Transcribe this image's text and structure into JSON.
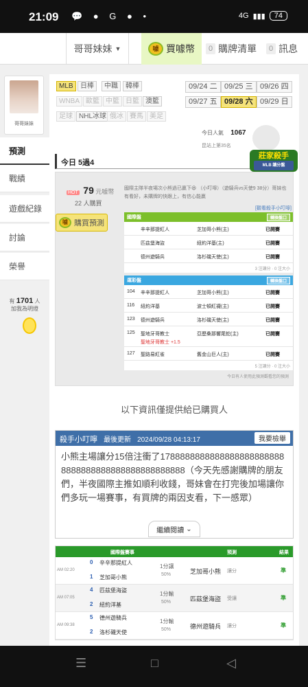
{
  "status": {
    "time": "21:09",
    "net": "4G",
    "battery": "74"
  },
  "nav": {
    "user": "哥哥妹妹",
    "buy_coin": "買噱幣",
    "coin_mark": "噱",
    "purchase_count": "0",
    "purchase_list": "購牌清單",
    "msg_count": "0",
    "messages": "訊息"
  },
  "profile": {
    "name": "哥哥妹妹"
  },
  "sidebar": {
    "items": [
      "預測",
      "戰績",
      "遊戲紀錄",
      "討論",
      "榮譽"
    ],
    "fans_prefix": "有",
    "fans_count": "1701",
    "fans_unit": "人",
    "fans_label": "加我為明燈"
  },
  "leagues": [
    {
      "label": "MLB",
      "state": "sel"
    },
    {
      "label": "日棒",
      "state": ""
    },
    {
      "label": "中職",
      "state": ""
    },
    {
      "label": "韓棒",
      "state": ""
    },
    {
      "label": "WNBA",
      "state": "dim"
    },
    {
      "label": "歐籃",
      "state": "dim"
    },
    {
      "label": "中籃",
      "state": "dim"
    },
    {
      "label": "日籃",
      "state": "dim"
    },
    {
      "label": "澳籃",
      "state": ""
    },
    {
      "label": "足球",
      "state": "dim"
    },
    {
      "label": "NHL冰球",
      "state": ""
    },
    {
      "label": "俄冰",
      "state": "dim"
    },
    {
      "label": "賽馬",
      "state": "dim"
    },
    {
      "label": "美足",
      "state": "dim"
    }
  ],
  "dates": [
    {
      "label": "09/24 二",
      "state": ""
    },
    {
      "label": "09/25 三",
      "state": ""
    },
    {
      "label": "09/26 四",
      "state": ""
    },
    {
      "label": "09/27 五",
      "state": ""
    },
    {
      "label": "09/28 六",
      "state": "sel"
    },
    {
      "label": "09/29 日",
      "state": ""
    }
  ],
  "stats": {
    "today_label": "今日人氣",
    "today_value": "1067",
    "rank": "昆站上第35名"
  },
  "rec": {
    "title": "今日 5過4",
    "badge_title": "莊家殺手",
    "badge_sub": "MLB 讓分盤"
  },
  "panel": {
    "hot": "HOT",
    "price": "79",
    "price_unit": "元噱幣",
    "buyers": "22 人購買",
    "buy_label": "購買預測",
    "intro": "國際主隊半夜場次小熊過已贏下😆 （小叮嚀）（遊騎兵vs天使9 38分）哥妹也有看好，未購牌的快跟上，有信心能贏",
    "sub_link": "[觀看殺手小叮嚀]",
    "t1": {
      "title": "國際盤",
      "more": "轉換盤口",
      "rows": [
        {
          "no": "",
          "away": "辛辛那提紅人",
          "home": "芝加哥小熊(主)",
          "status": "已開賽"
        },
        {
          "no": "",
          "away": "匹茲堡海盜",
          "home": "紐約洋基(主)",
          "status": "已開賽"
        },
        {
          "no": "",
          "away": "德州遊騎兵",
          "home": "洛杉磯天使(主)",
          "status": "已開賽"
        }
      ],
      "foot": "3 注讓分 · 0 注大小"
    },
    "t2": {
      "title": "運彩盤",
      "more": "轉換盤口",
      "rows": [
        {
          "no": "104",
          "away": "辛辛那提紅人",
          "home": "芝加哥小熊(主)",
          "status": "已開賽"
        },
        {
          "no": "116",
          "away": "紐約洋基",
          "home": "波士頓紅襪(主)",
          "status": "已開賽"
        },
        {
          "no": "123",
          "away": "德州遊騎兵",
          "home": "洛杉磯天使(主)",
          "status": "已開賽"
        },
        {
          "no": "125",
          "away": "聖地牙哥教士",
          "home": "亞歷桑那響尾蛇(主)",
          "status": "已開賽",
          "extra": "聖地牙哥教士 +1.5"
        },
        {
          "no": "127",
          "away": "聖路易紅雀",
          "home": "舊金山巨人(主)",
          "status": "已開賽"
        }
      ],
      "foot": "5 注讓分 · 0 注大小"
    },
    "note": "今日有人使用此預測觀看您的預測"
  },
  "purchase_msg": "以下資訊僅提供給已購買人",
  "msg": {
    "title": "殺手小叮嚀",
    "updated_label": "最後更新",
    "updated": "2024/09/28 04:13:17",
    "my_info": "我要檢舉",
    "text": "小熊主場讓分15倍注衝了17888888888888888888888888888888888888888888888888（今天先感謝購牌的朋友們，半夜國際主推如順利收錢，哥妹會在打完後加場讓你們多玩一場賽事，有買牌的兩因支看，下一感眾）"
  },
  "read_more": "繼續閱讀",
  "pred": {
    "col_match": "國際盤賽事",
    "col_pred": "預測",
    "col_result": "結果",
    "rows": [
      {
        "time": "AM 02:20",
        "s1": "0",
        "t1": "辛辛那提紅人",
        "s2": "1",
        "t2": "芝加哥小熊",
        "line": "1分讓",
        "pct": "50%",
        "pick": "芝加哥小熊",
        "pt": "讓分",
        "res": "準"
      },
      {
        "time": "AM 07:05",
        "s1": "4",
        "t1": "匹茲堡海盜",
        "s2": "2",
        "t2": "紐約洋基",
        "line": "1分輸",
        "pct": "50%",
        "pick": "匹茲堡海盜",
        "pt": "受讓",
        "res": "準"
      },
      {
        "time": "AM 09:38",
        "s1": "5",
        "t1": "德州遊騎兵",
        "s2": "2",
        "t2": "洛杉磯天使",
        "line": "1分輸",
        "pct": "50%",
        "pick": "德州遊騎兵",
        "pt": "讓分",
        "res": "準"
      }
    ]
  }
}
